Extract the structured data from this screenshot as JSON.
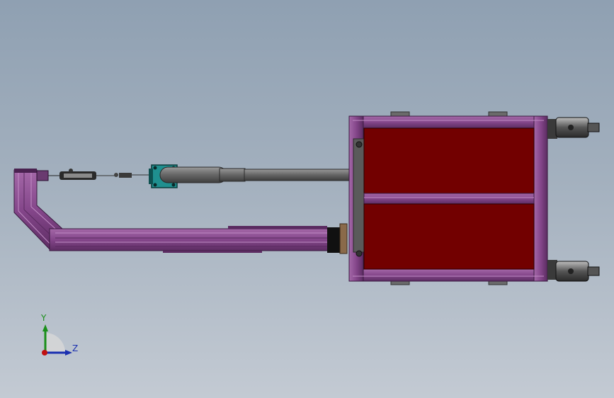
{
  "triad": {
    "y_label": "Y",
    "z_label": "Z"
  },
  "colors": {
    "frame": "#8a4a8f",
    "frame_dark": "#5a2a60",
    "panel": "#720000",
    "pipe": "#6c6c6c",
    "teal": "#1f8f8f",
    "y_axis": "#1a8f1a",
    "z_axis": "#1a2fb0"
  }
}
